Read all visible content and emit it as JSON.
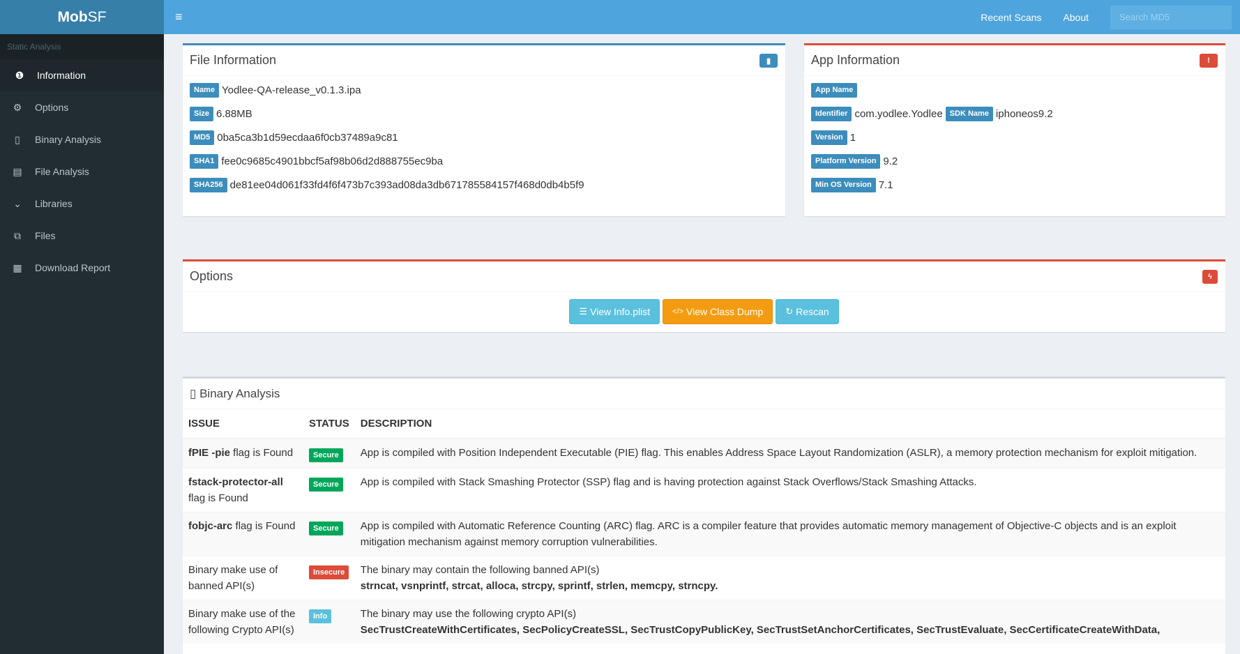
{
  "sidebar": {
    "logo_bold": "Mob",
    "logo_rest": "SF",
    "header": "Static Analysis",
    "items": [
      {
        "label": "Information",
        "icon": "info-circle-icon",
        "glyph": "❶"
      },
      {
        "label": "Options",
        "icon": "cogs-icon",
        "glyph": "⚙"
      },
      {
        "label": "Binary Analysis",
        "icon": "mobile-icon",
        "glyph": "▯"
      },
      {
        "label": "File Analysis",
        "icon": "file-text-icon",
        "glyph": "▤"
      },
      {
        "label": "Libraries",
        "icon": "chevron-down-icon",
        "glyph": "⌄"
      },
      {
        "label": "Files",
        "icon": "copy-icon",
        "glyph": "⧉"
      },
      {
        "label": "Download Report",
        "icon": "list-alt-icon",
        "glyph": "▦"
      }
    ]
  },
  "header": {
    "hamburger_glyph": "≡",
    "links": [
      "Recent Scans",
      "About"
    ],
    "search_placeholder": "Search MD5"
  },
  "file_info": {
    "title": "File Information",
    "icon_glyph": "▮",
    "rows": [
      {
        "label": "Name",
        "value": "Yodlee-QA-release_v0.1.3.ipa"
      },
      {
        "label": "Size",
        "value": "6.88MB"
      },
      {
        "label": "MD5",
        "value": "0ba5ca3b1d59ecdaa6f0cb37489a9c81"
      },
      {
        "label": "SHA1",
        "value": "fee0c9685c4901bbcf5af98b06d2d888755ec9ba"
      },
      {
        "label": "SHA256",
        "value": "de81ee04d061f33fd4f6f473b7c393ad08da3db671785584157f468d0db4b5f9"
      }
    ]
  },
  "app_info": {
    "title": "App Information",
    "icon_glyph": "!",
    "app_name_label": "App Name",
    "identifier_label": "Identifier",
    "identifier_value": "com.yodlee.Yodlee",
    "sdk_label": "SDK Name",
    "sdk_value": "iphoneos9.2",
    "version_label": "Version",
    "version_value": "1",
    "platform_label": "Platform Version",
    "platform_value": "9.2",
    "minos_label": "Min OS Version",
    "minos_value": "7.1"
  },
  "options": {
    "title": "Options",
    "icon_glyph": "ϟ",
    "buttons": [
      {
        "label": "View Info.plist",
        "glyph": "☰"
      },
      {
        "label": "View Class Dump",
        "glyph": "</>"
      },
      {
        "label": "Rescan",
        "glyph": "↻"
      }
    ]
  },
  "binary": {
    "title_glyph": "▯",
    "title": "Binary Analysis",
    "columns": [
      "ISSUE",
      "STATUS",
      "DESCRIPTION"
    ],
    "rows": [
      {
        "issue_bold": "fPIE -pie",
        "issue_rest": " flag is Found",
        "status": "Secure",
        "desc": "App is compiled with Position Independent Executable (PIE) flag. This enables Address Space Layout Randomization (ASLR), a memory protection mechanism for exploit mitigation.",
        "desc_bold": ""
      },
      {
        "issue_bold": "fstack-protector-all",
        "issue_rest": " flag is Found",
        "status": "Secure",
        "desc": "App is compiled with Stack Smashing Protector (SSP) flag and is having protection against Stack Overflows/Stack Smashing Attacks.",
        "desc_bold": ""
      },
      {
        "issue_bold": "fobjc-arc",
        "issue_rest": " flag is Found",
        "status": "Secure",
        "desc": "App is compiled with Automatic Reference Counting (ARC) flag. ARC is a compiler feature that provides automatic memory management of Objective-C objects and is an exploit mitigation mechanism against memory corruption vulnerabilities.",
        "desc_bold": ""
      },
      {
        "issue_bold": "",
        "issue_rest": "Binary make use of banned API(s)",
        "status": "Insecure",
        "desc": "The binary may contain the following banned API(s)",
        "desc_bold": "strncat, vsnprintf, strcat, alloca, strcpy, sprintf, strlen, memcpy, strncpy."
      },
      {
        "issue_bold": "",
        "issue_rest": "Binary make use of the following Crypto API(s)",
        "status": "Info",
        "desc": "The binary may use the following crypto API(s)",
        "desc_bold": "SecTrustCreateWithCertificates, SecPolicyCreateSSL, SecTrustCopyPublicKey, SecTrustSetAnchorCertificates, SecTrustEvaluate, SecCertificateCreateWithData,"
      }
    ]
  },
  "colors": {
    "topbar": "#4ea4dc",
    "sidebar": "#222d32",
    "primary": "#3c8dbc",
    "danger": "#dd4b39",
    "success": "#00a65a",
    "warning": "#f39c12",
    "info": "#5bc0de"
  }
}
